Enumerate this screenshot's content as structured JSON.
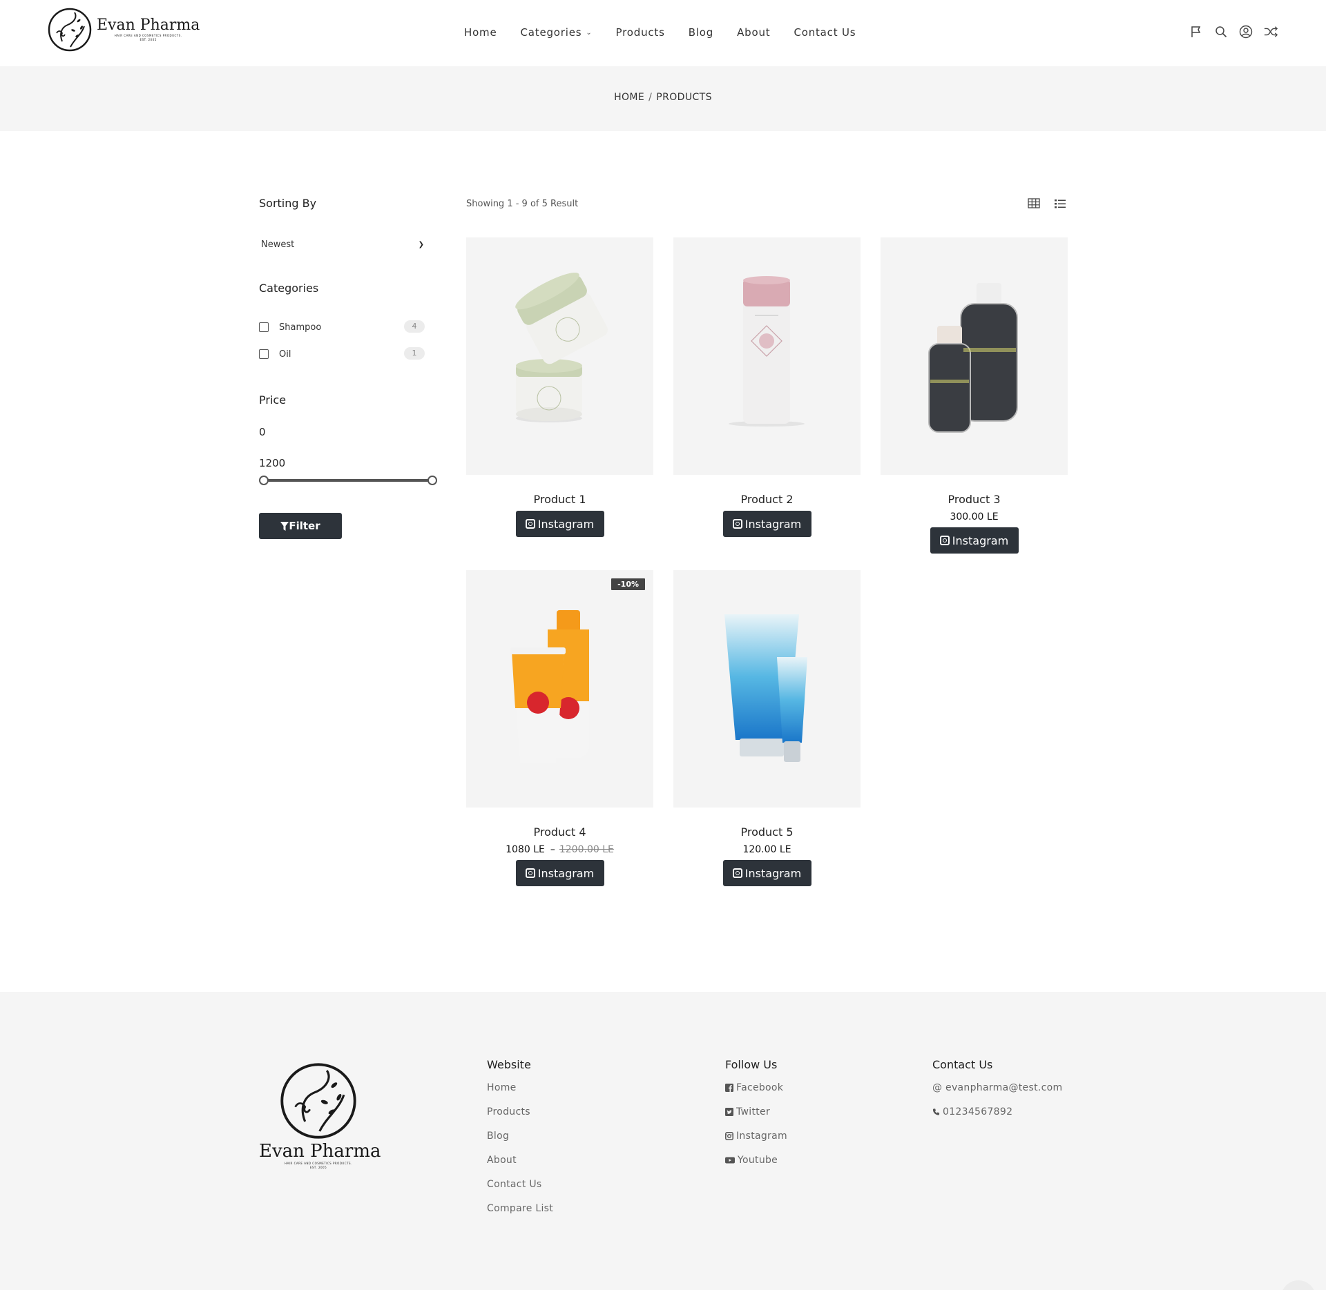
{
  "brand": {
    "name": "Evan Pharma",
    "tagline": "HAIR CARE AND COSMETICS PRODUCTS.",
    "est": "EST. 2005"
  },
  "nav": {
    "items": [
      {
        "label": "Home"
      },
      {
        "label": "Categories"
      },
      {
        "label": "Products"
      },
      {
        "label": "Blog"
      },
      {
        "label": "About"
      },
      {
        "label": "Contact Us"
      }
    ],
    "icons": [
      "flag-icon",
      "search-icon",
      "user-icon",
      "shuffle-icon"
    ]
  },
  "breadcrumb": {
    "home": "HOME",
    "separator": "/",
    "current": "PRODUCTS"
  },
  "sidebar": {
    "sorting_title": "Sorting By",
    "sort_value": "Newest",
    "categories_title": "Categories",
    "categories": [
      {
        "name": "Shampoo",
        "count": "4"
      },
      {
        "name": "Oil",
        "count": "1"
      }
    ],
    "price_title": "Price",
    "price_min": "0",
    "price_max": "1200",
    "slider_min_fraction": 0,
    "slider_max_fraction": 1,
    "filter_label": "Filter"
  },
  "results": {
    "showing": "Showing 1 - 9 of 5 Result"
  },
  "products": [
    {
      "name": "Product 1",
      "price": "",
      "old_price": "",
      "button": "Instagram"
    },
    {
      "name": "Product 2",
      "price": "",
      "old_price": "",
      "button": "Instagram"
    },
    {
      "name": "Product 3",
      "price": "300.00 LE",
      "old_price": "",
      "button": "Instagram"
    },
    {
      "name": "Product 4",
      "price": "1080 LE",
      "old_price": "1200.00 LE",
      "badge": "-10%",
      "button": "Instagram"
    },
    {
      "name": "Product 5",
      "price": "120.00 LE",
      "old_price": "",
      "button": "Instagram"
    }
  ],
  "footer": {
    "website_title": "Website",
    "website_links": [
      "Home",
      "Products",
      "Blog",
      "About",
      "Contact Us",
      "Compare List"
    ],
    "follow_title": "Follow Us",
    "follow_links": [
      {
        "label": "Facebook",
        "icon": "facebook-icon"
      },
      {
        "label": "Twitter",
        "icon": "twitter-icon"
      },
      {
        "label": "Instagram",
        "icon": "instagram-icon"
      },
      {
        "label": "Youtube",
        "icon": "youtube-icon"
      }
    ],
    "contact_title": "Contact Us",
    "email": "@ evanpharma@test.com",
    "phone": "01234567892"
  },
  "colors": {
    "button_bg": "#2d333a",
    "band_bg": "#f5f5f5",
    "card_bg": "#f4f4f4"
  }
}
